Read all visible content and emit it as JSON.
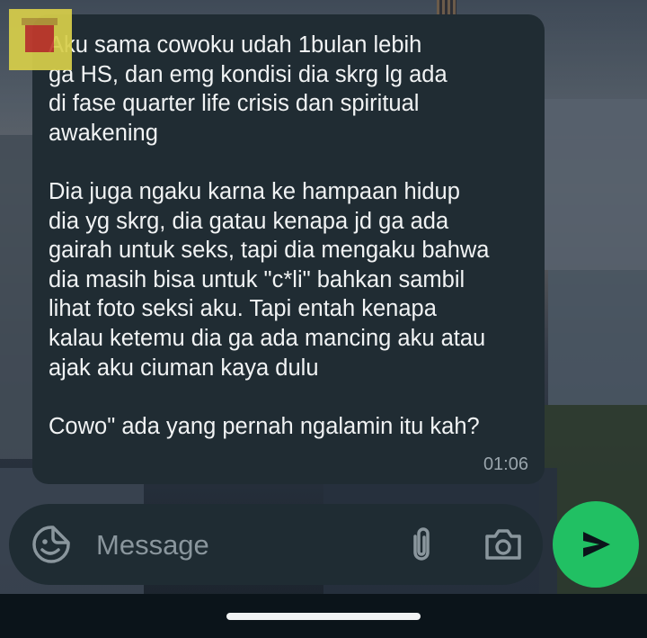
{
  "message": {
    "text": "Aku sama cowoku udah 1bulan lebih\nga HS, dan emg kondisi dia skrg lg ada\ndi fase quarter life crisis dan spiritual\nawakening\n\nDia juga ngaku karna ke hampaan hidup\ndia yg skrg, dia gatau kenapa jd ga ada\ngairah untuk seks, tapi dia mengaku bahwa\ndia masih bisa untuk \"c*li\" bahkan sambil\nlihat foto seksi aku. Tapi entah kenapa\nkalau ketemu dia ga ada mancing aku atau\najak aku ciuman kaya dulu\n\nCowo\" ada yang pernah ngalamin itu kah?",
    "time": "01:06"
  },
  "composer": {
    "placeholder": "Message",
    "emoji_icon": "sticker-emoji-icon",
    "attach_icon": "paperclip-icon",
    "camera_icon": "camera-icon"
  },
  "send": {
    "icon": "send-icon",
    "color": "#21c063"
  },
  "colors": {
    "bubble": "#202c33",
    "composer": "#1f2c33",
    "text": "#f1f3f4",
    "placeholder": "#8a969d",
    "nav_bar": "#0b141a"
  }
}
